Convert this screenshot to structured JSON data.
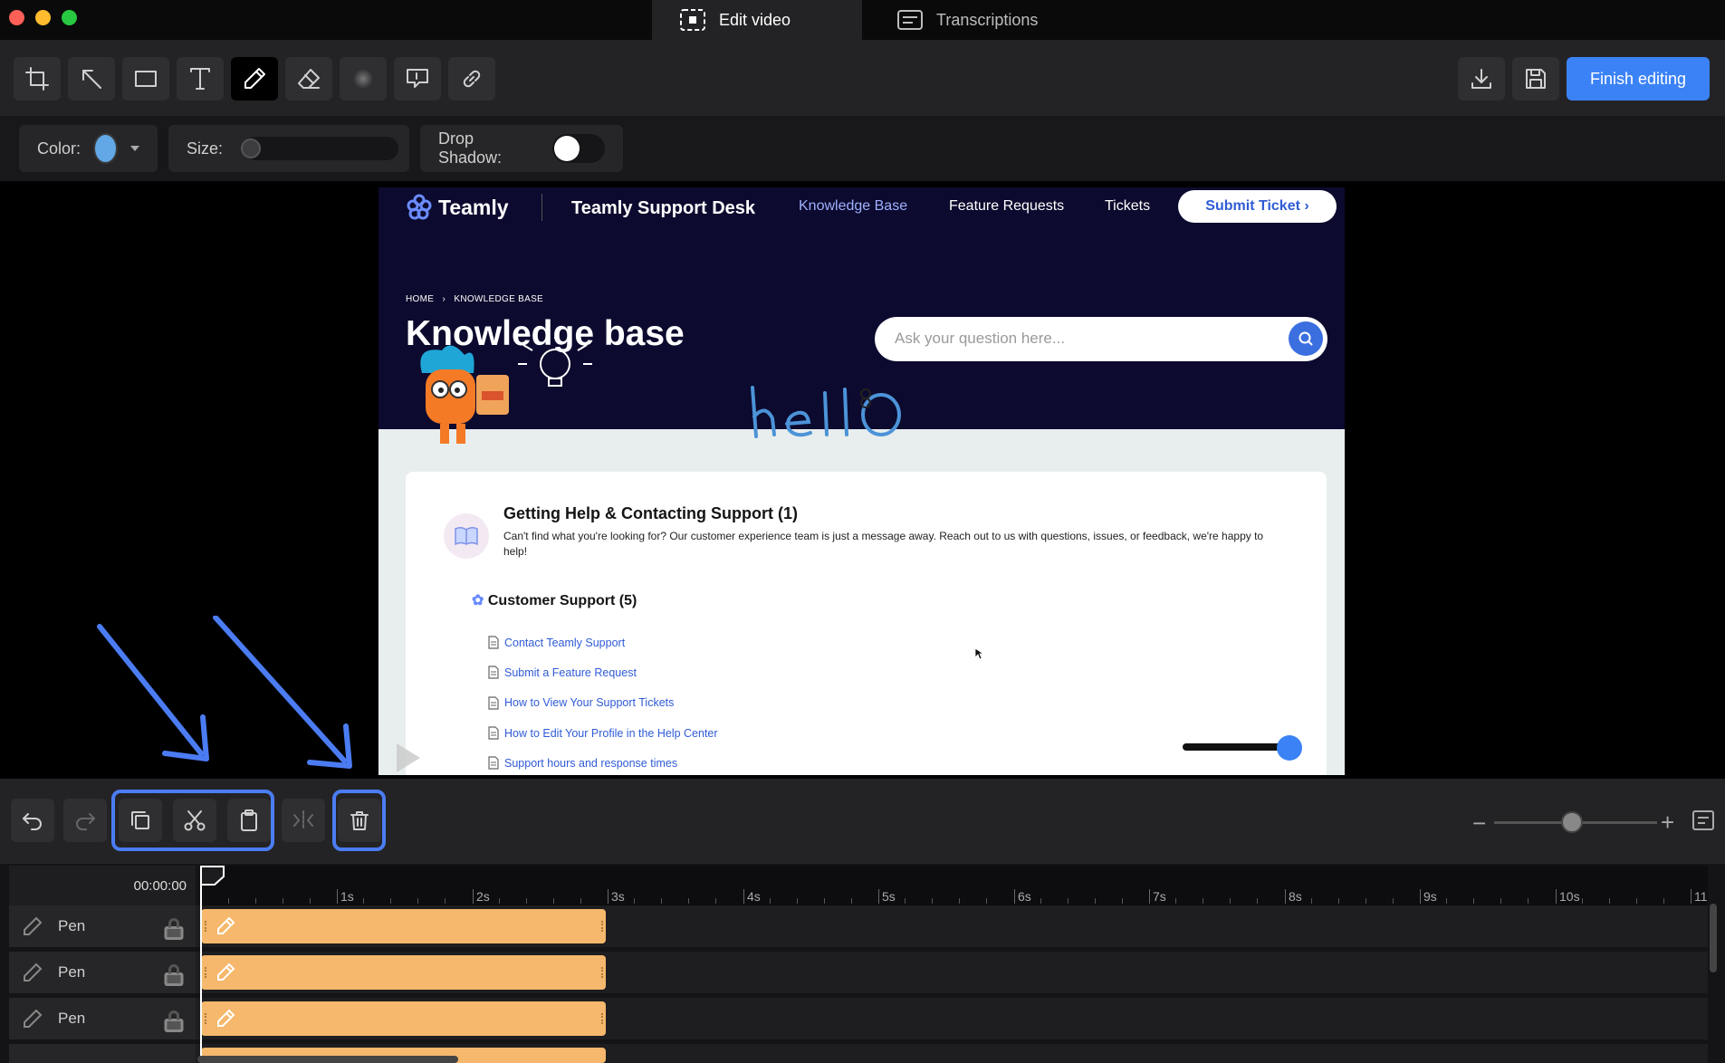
{
  "window": {
    "tabs": [
      {
        "label": "Edit video",
        "active": true
      },
      {
        "label": "Transcriptions",
        "active": false
      }
    ]
  },
  "toolbar": {
    "tools": [
      "crop-icon",
      "arrow-icon",
      "rectangle-icon",
      "text-icon",
      "pen-icon",
      "eraser-icon",
      "blur-icon",
      "callout-icon",
      "link-icon"
    ],
    "selected_tool": "pen-icon",
    "finish_label": "Finish editing"
  },
  "properties": {
    "color_label": "Color:",
    "color_value": "#62a8e6",
    "size_label": "Size:",
    "shadow_label": "Drop Shadow:"
  },
  "preview": {
    "logo": "Teamly",
    "desk_title": "Teamly Support Desk",
    "nav": [
      "Knowledge Base",
      "Feature Requests",
      "Tickets"
    ],
    "submit": "Submit Ticket ›",
    "breadcrumb_home": "HOME",
    "breadcrumb_current": "KNOWLEDGE BASE",
    "page_title": "Knowledge base",
    "search_placeholder": "Ask your question here...",
    "annotation_text": "hello",
    "section1_title": "Getting Help & Contacting Support (1)",
    "section1_desc": "Can't find what you're looking for? Our customer experience team is just a message away. Reach out to us with questions, issues, or feedback, we're happy to help!",
    "section2_title": "Customer Support (5)",
    "links": [
      "Contact Teamly Support",
      "Submit a Feature Request",
      "How to View Your Support Tickets",
      "How to Edit Your Profile in the Help Center",
      "Support hours and response times"
    ]
  },
  "edit_toolbar": {
    "tools": [
      "undo-icon",
      "redo-icon",
      "copy-icon",
      "cut-icon",
      "paste-icon",
      "split-icon",
      "delete-icon"
    ]
  },
  "timeline": {
    "current_time": "00:00:00",
    "ticks": [
      "1s",
      "2s",
      "3s",
      "4s",
      "5s",
      "6s",
      "7s",
      "8s",
      "9s",
      "10s",
      "11"
    ],
    "tracks": [
      {
        "label": "Pen"
      },
      {
        "label": "Pen"
      },
      {
        "label": "Pen"
      }
    ]
  },
  "colors": {
    "accent": "#3b82f6",
    "clip": "#f5b86c",
    "highlight": "#4b7cf3",
    "hero": "#0c0a2e"
  }
}
